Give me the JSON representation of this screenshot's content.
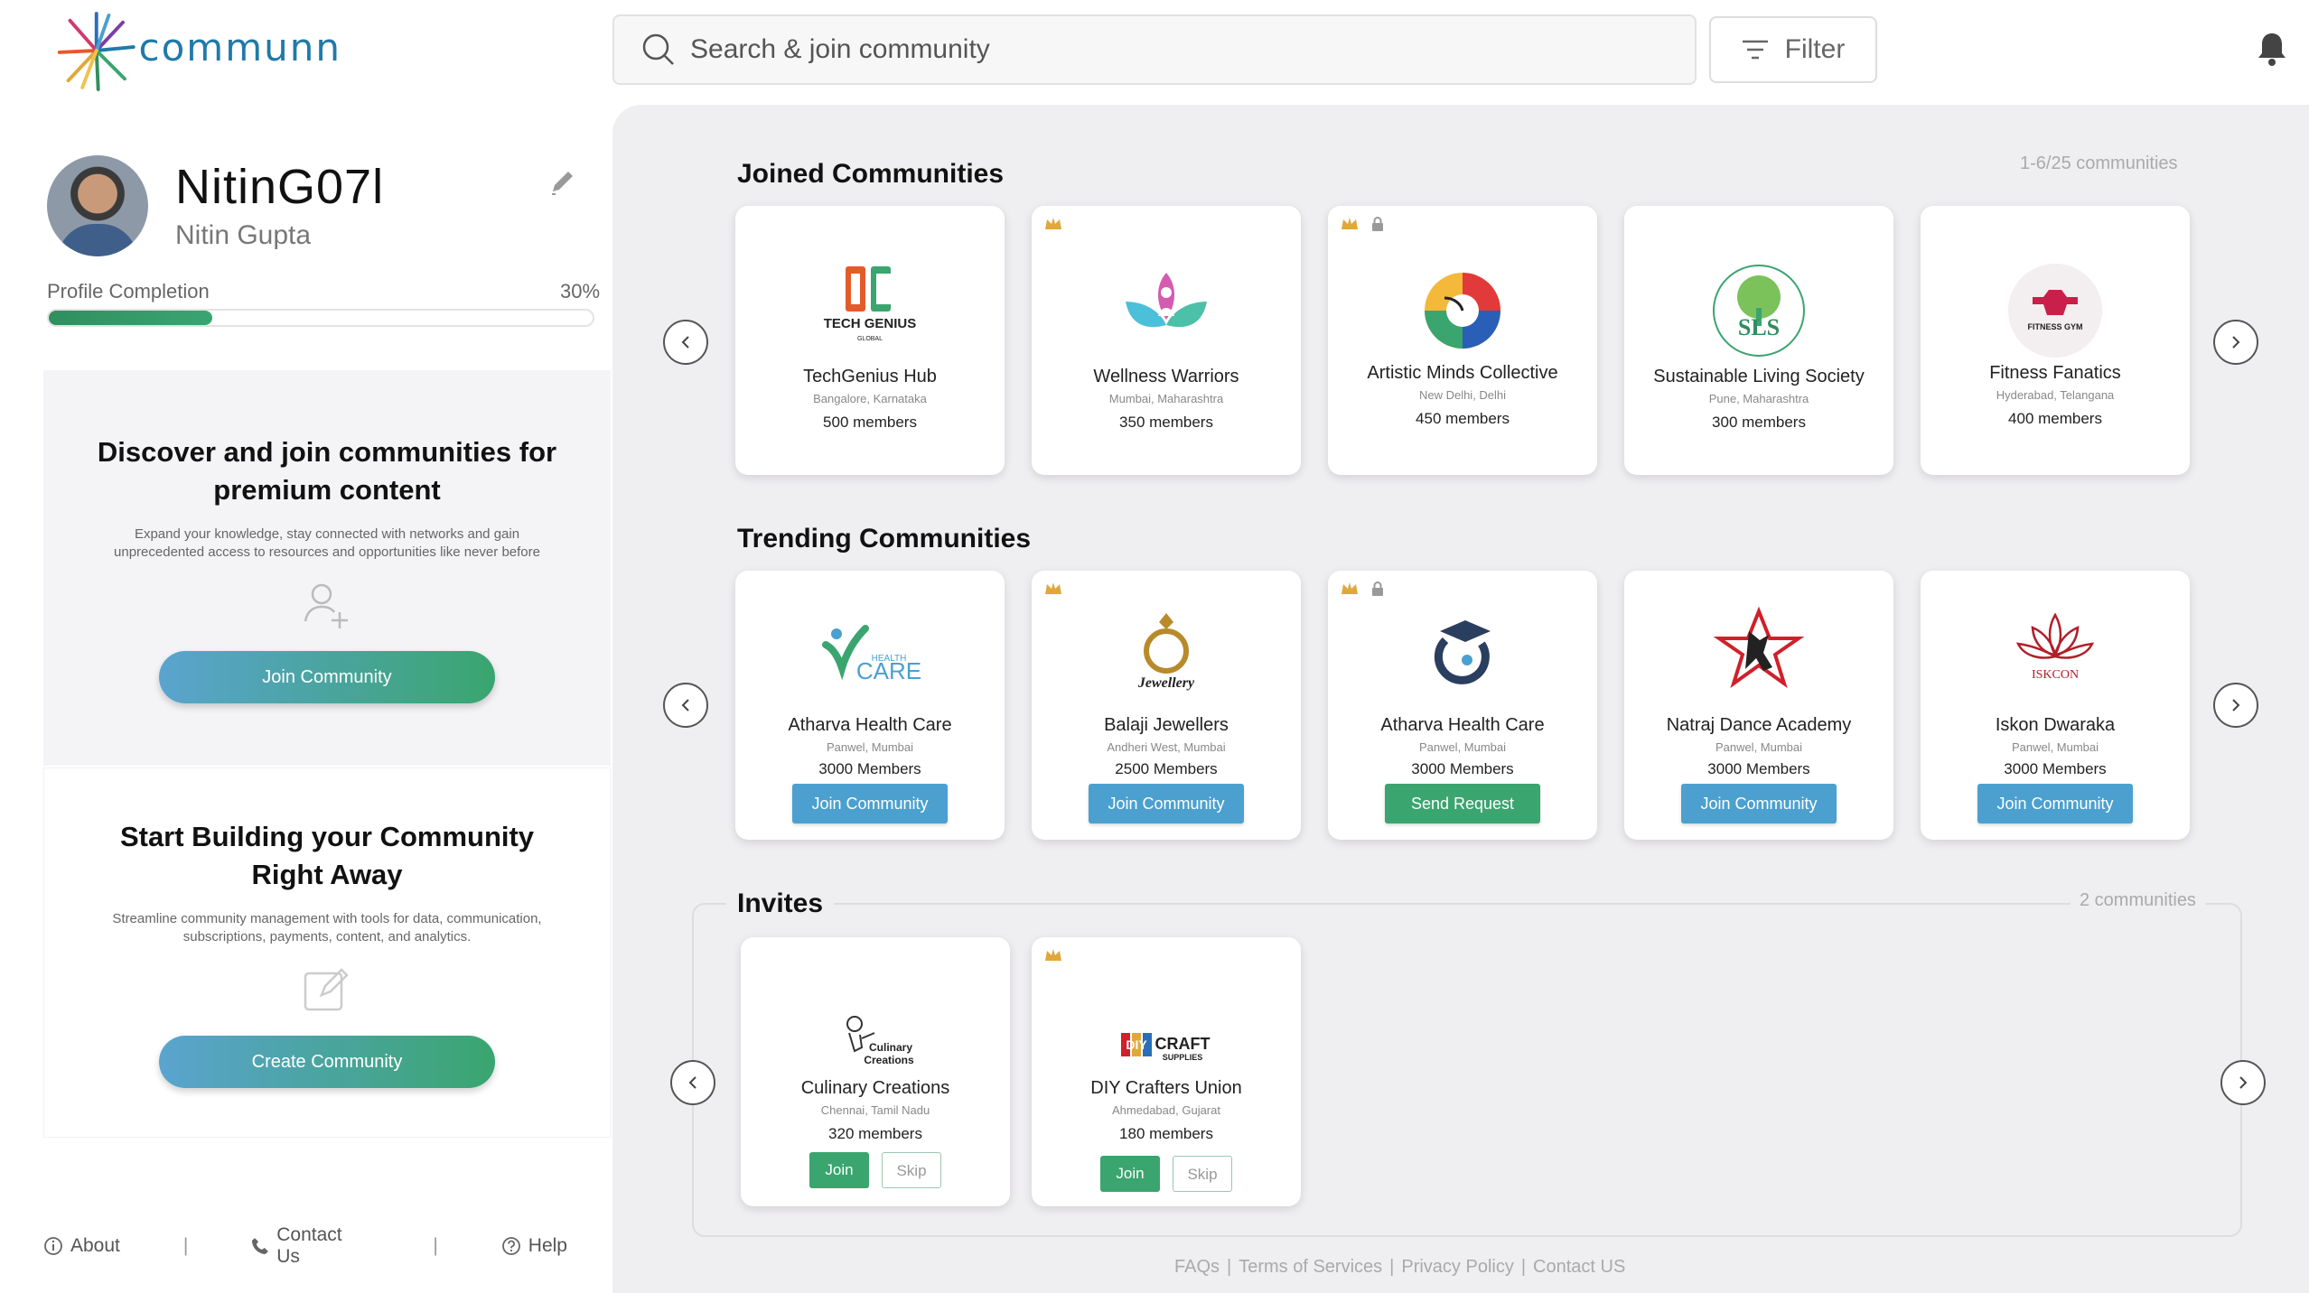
{
  "brand": {
    "name": "communn"
  },
  "search": {
    "placeholder": "Search & join community"
  },
  "filter": {
    "label": "Filter"
  },
  "profile": {
    "username": "NitinG07l",
    "full_name": "Nitin Gupta",
    "completion_label": "Profile Completion",
    "completion_text": "30%",
    "completion": 0.3
  },
  "discover": {
    "title": "Discover and join communities for premium content",
    "description": "Expand your knowledge, stay connected with networks and gain unprecedented access to resources and opportunities like never before",
    "button": "Join Community"
  },
  "build": {
    "title": "Start Building your Community Right Away",
    "description": "Streamline community management with tools for data, communication, subscriptions, payments, content, and analytics.",
    "button": "Create Community"
  },
  "footer_left": {
    "about": "About",
    "contact": "Contact Us",
    "help": "Help"
  },
  "joined": {
    "title": "Joined Communities",
    "count": "1-6/25 communities",
    "items": [
      {
        "name": "TechGenius Hub",
        "location": "Bangalore, Karnataka",
        "members": "500 members",
        "logo_text": "TECH GENIUS",
        "logo_sub": "GLOBAL"
      },
      {
        "name": "Wellness Warriors",
        "location": "Mumbai, Maharashtra",
        "members": "350 members"
      },
      {
        "name": "Artistic Minds Collective",
        "location": "New Delhi, Delhi",
        "members": "450 members"
      },
      {
        "name": "Sustainable Living Society",
        "location": "Pune, Maharashtra",
        "members": "300 members",
        "logo_text": "SLS"
      },
      {
        "name": "Fitness Fanatics",
        "location": "Hyderabad, Telangana",
        "members": "400 members",
        "logo_text": "FITNESS GYM"
      }
    ]
  },
  "trending": {
    "title": "Trending Communities",
    "items": [
      {
        "name": "Atharva Health Care",
        "location": "Panwel, Mumbai",
        "members": "3000 Members",
        "button": "Join Community",
        "logo_text": "CARE",
        "logo_sub": "HEALTH"
      },
      {
        "name": "Balaji Jewellers",
        "location": "Andheri West, Mumbai",
        "members": "2500 Members",
        "button": "Join Community",
        "logo_text": "Jewellery"
      },
      {
        "name": "Atharva Health Care",
        "location": "Panwel, Mumbai",
        "members": "3000 Members",
        "button": "Send Request"
      },
      {
        "name": "Natraj Dance Academy",
        "location": "Panwel, Mumbai",
        "members": "3000 Members",
        "button": "Join Community"
      },
      {
        "name": "Iskon Dwaraka",
        "location": "Panwel, Mumbai",
        "members": "3000 Members",
        "button": "Join Community",
        "logo_text": "ISKCON"
      }
    ]
  },
  "invites": {
    "title": "Invites",
    "count": "2 communities",
    "items": [
      {
        "name": "Culinary Creations",
        "location": "Chennai, Tamil Nadu",
        "members": "320 members",
        "join": "Join",
        "skip": "Skip",
        "logo_text": "Culinary",
        "logo_sub": "Creations"
      },
      {
        "name": "DIY Crafters Union",
        "location": "Ahmedabad, Gujarat",
        "members": "180 members",
        "join": "Join",
        "skip": "Skip",
        "logo_text": "DIY",
        "logo_craft": "CRAFT",
        "logo_sub": "SUPPLIES"
      }
    ]
  },
  "footer_links": {
    "faqs": "FAQs",
    "terms": "Terms of Services",
    "privacy": "Privacy Policy",
    "contact": "Contact US",
    "sep": "|"
  },
  "colors": {
    "accent_blue": "#4ba0cf",
    "accent_green": "#3aa56f",
    "premium_crown": "#e0a83a"
  }
}
